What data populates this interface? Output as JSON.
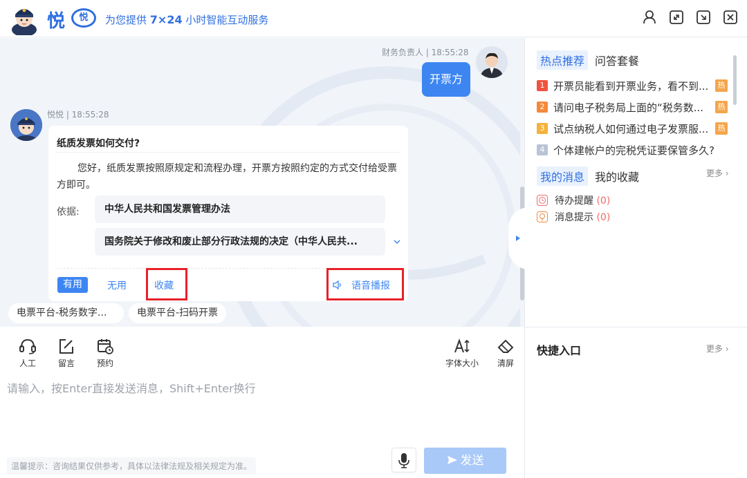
{
  "header": {
    "brand": "悦",
    "badge": "悦",
    "tagline_pre": "为您提供 ",
    "tagline_em": "7×24",
    "tagline_post": " 小时智能互动服务"
  },
  "chat": {
    "user_meta": "财务负责人 | 18:55:28",
    "user_message": "开票方",
    "bot_meta": "悦悦 | 18:55:28",
    "answer_title": "纸质发票如何交付?",
    "answer_text": "您好，纸质发票按照原规定和流程办理，开票方按照约定的方式交付给受票方即可。",
    "basis_label": "依据:",
    "laws": [
      "中华人民共和国发票管理办法",
      "国务院关于修改和废止部分行政法规的决定（中华人民共..."
    ],
    "actions": {
      "useful": "有用",
      "useless": "无用",
      "favorite": "收藏",
      "voice": "语音播报"
    },
    "suggestions": [
      "电票平台-税务数字...",
      "电票平台-扫码开票"
    ]
  },
  "toolbar": {
    "tools": [
      {
        "label": "人工",
        "icon": "headset-icon"
      },
      {
        "label": "留言",
        "icon": "edit-icon"
      },
      {
        "label": "预约",
        "icon": "calendar-clock-icon"
      },
      {
        "label": "字体大小",
        "icon": "font-size-icon"
      },
      {
        "label": "清屏",
        "icon": "eraser-icon"
      }
    ]
  },
  "input": {
    "placeholder": "请输入，按Enter直接发送消息，Shift+Enter换行",
    "tip": "温馨提示：咨询结果仅供参考，具体以法律法规及相关规定为准。",
    "send_label": "发送"
  },
  "right_panel": {
    "tabs1": [
      "热点推荐",
      "问答套餐"
    ],
    "hot_items": [
      {
        "num": "1",
        "text": "开票员能看到开票业务，看不到...",
        "tag": "热",
        "color": "#f0533f"
      },
      {
        "num": "2",
        "text": "请问电子税务局上面的“税务数...",
        "tag": "热",
        "color": "#f5883a"
      },
      {
        "num": "3",
        "text": "试点纳税人如何通过电子发票服...",
        "tag": "热",
        "color": "#f5b23a"
      },
      {
        "num": "4",
        "text": "个体建帐户的完税凭证要保管多久?",
        "tag": "",
        "color": "#b9c4d6"
      }
    ],
    "tabs2": [
      "我的消息",
      "我的收藏"
    ],
    "more1": "更多",
    "messages": [
      {
        "label": "待办提醒",
        "count": "(0)"
      },
      {
        "label": "消息提示",
        "count": "(0)"
      }
    ],
    "quick_title": "快捷入口",
    "more2": "更多"
  },
  "colors": {
    "accent": "#3d86f2",
    "brand": "#2f6fe0",
    "highlight_box": "#e8202a",
    "send_disabled": "#a9c9f8"
  }
}
